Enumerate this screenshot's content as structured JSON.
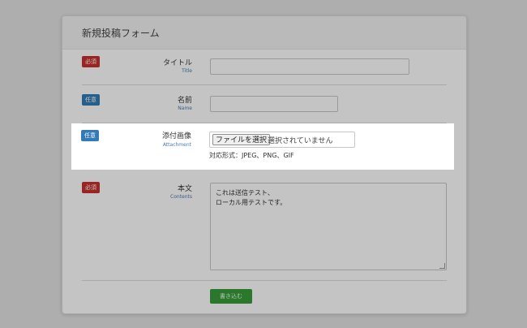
{
  "form": {
    "title": "新規投稿フォーム",
    "badges": {
      "required": "必須",
      "optional": "任意"
    },
    "fields": {
      "title": {
        "label": "タイトル",
        "label_en": "Title",
        "value": ""
      },
      "name": {
        "label": "名前",
        "label_en": "Name",
        "value": ""
      },
      "attachment": {
        "label": "添付画像",
        "label_en": "Attachment",
        "button": "ファイルを選択",
        "status": "選択されていません",
        "note": "対応形式：JPEG、PNG、GIF"
      },
      "body": {
        "label": "本文",
        "label_en": "Contents",
        "lines": [
          "これは送信テスト、",
          "ローカル用テストです。"
        ]
      }
    },
    "submit": "書き込む"
  },
  "colors": {
    "required_badge": "#c9302c",
    "optional_badge": "#337ab7",
    "submit_button": "#3a9b3a"
  }
}
